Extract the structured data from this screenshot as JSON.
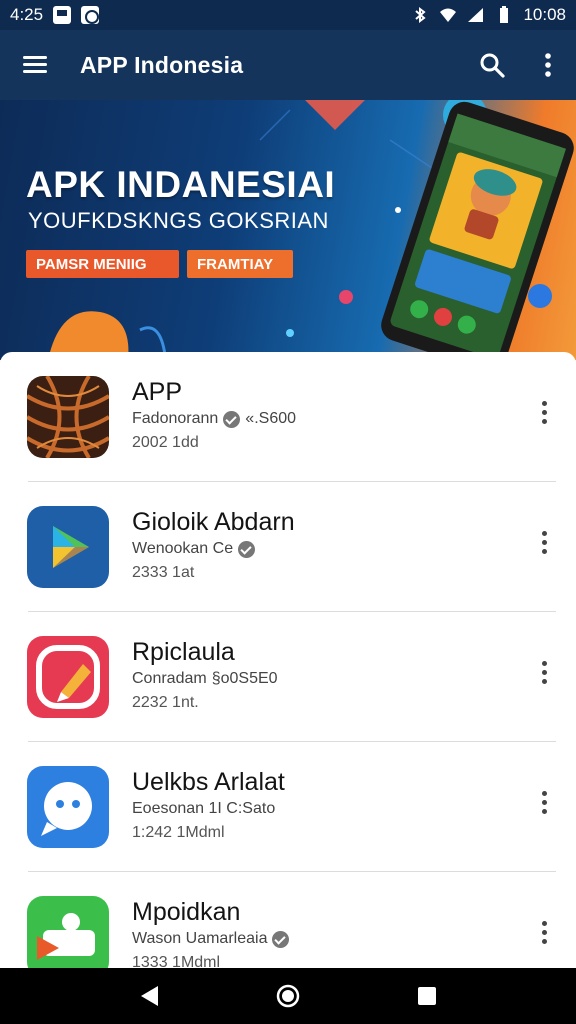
{
  "status_bar": {
    "left_time": "4:25",
    "right_time": "10:08"
  },
  "app_bar": {
    "title": "APP Indonesia",
    "icons": [
      "menu-icon",
      "search-icon",
      "more-vert-icon"
    ]
  },
  "banner": {
    "title": "APK INDANESIAI",
    "subtitle": "YOUFKDSKNGS GOKSRIAN",
    "button1": "PAMSR MENIIG",
    "button2": "FRAMTIAY"
  },
  "apps": [
    {
      "name": "APP",
      "developer": "Fadonorann",
      "extra": "«.S600",
      "meta": "2002 1dd",
      "icon": "pattern-app-icon"
    },
    {
      "name": "Gioloik Abdarn",
      "developer": "Wenookan Ce",
      "extra": "",
      "meta": "2333 1at",
      "icon": "play-app-icon"
    },
    {
      "name": "Rpiclaula",
      "developer": "Conradam",
      "extra": "§o0S5E0",
      "meta": "2232 1nt.",
      "icon": "pencil-app-icon"
    },
    {
      "name": "Uelkbs Arlalat",
      "developer": "Eoesonan 1I C:Sato",
      "extra": "",
      "meta": "1:242 1Mdml",
      "icon": "chat-app-icon"
    },
    {
      "name": "Mpoidkan",
      "developer": "Wason Uamarleaia",
      "extra": "",
      "meta": "1333 1Mdml",
      "icon": "photo-app-icon"
    }
  ],
  "colors": {
    "status_bar": "#0f2a4f",
    "app_bar": "#14345c",
    "accent_orange": "#e8582a"
  }
}
